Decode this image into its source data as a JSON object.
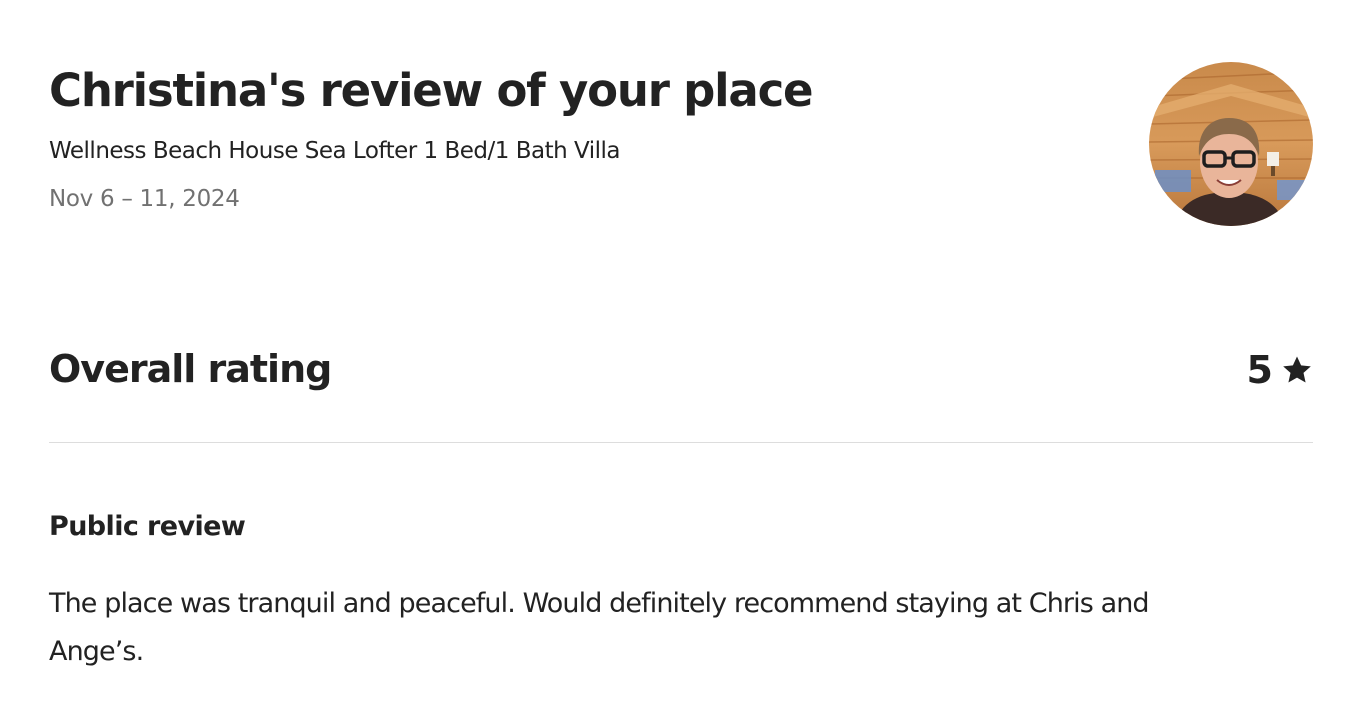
{
  "review": {
    "title": "Christina's review of your place",
    "listing_name": "Wellness Beach House Sea Lofter 1 Bed/1 Bath Villa",
    "stay_dates": "Nov 6 – 11, 2024"
  },
  "reviewer": {
    "avatar_icon": "reviewer-avatar-photo"
  },
  "overall_rating": {
    "label": "Overall rating",
    "value": "5",
    "icon": "star-icon"
  },
  "public_review": {
    "heading": "Public review",
    "text": "The place was tranquil and peaceful. Would definitely recommend staying at Chris and Ange’s."
  },
  "colors": {
    "text_primary": "#222222",
    "text_secondary": "#717171",
    "divider": "#dddddd"
  }
}
